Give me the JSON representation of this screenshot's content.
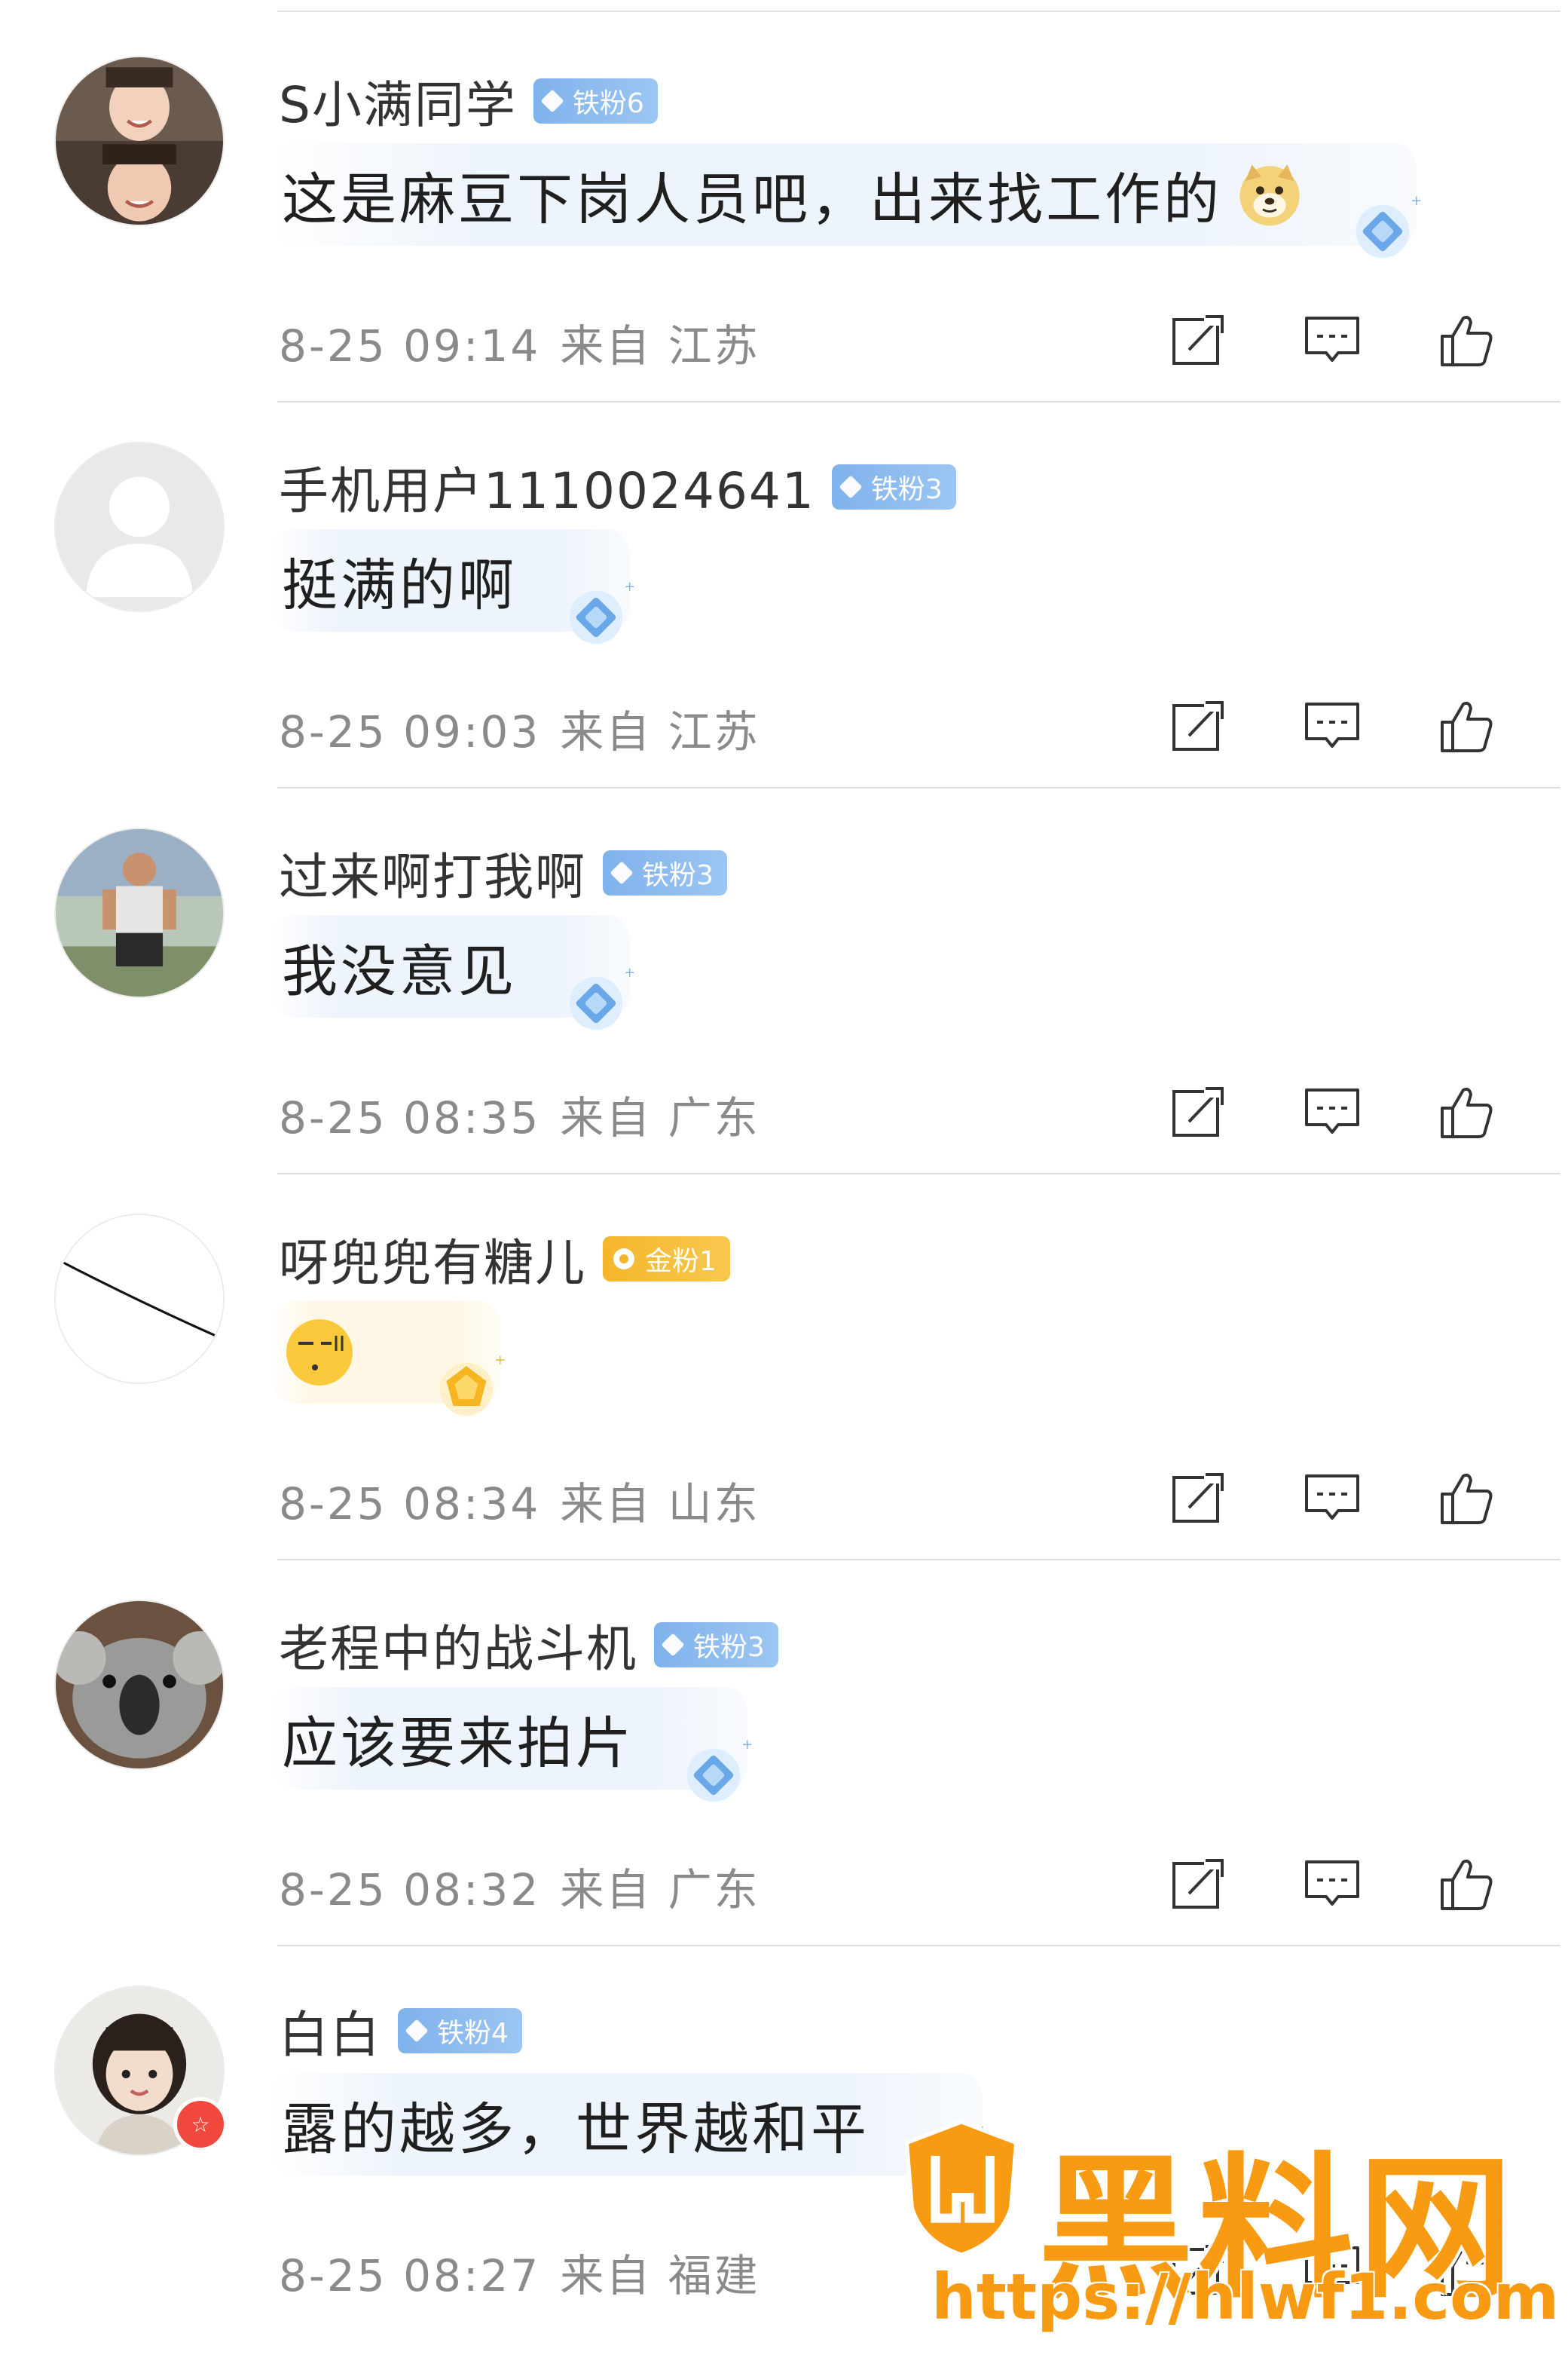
{
  "comments": [
    {
      "username": "S小满同学",
      "badge": "铁粉6",
      "badge_type": "blue",
      "text": "这是麻豆下岗人员吧，出来找工作的",
      "inline_emoji": "doge-emoji",
      "date": "8-25 09:14",
      "location": "来自 江苏",
      "avatar": "two-girls-photo"
    },
    {
      "username": "手机用户1110024641",
      "badge": "铁粉3",
      "badge_type": "blue",
      "text": "挺满的啊",
      "date": "8-25 09:03",
      "location": "来自 江苏",
      "avatar": "default-avatar"
    },
    {
      "username": "过来啊打我啊",
      "badge": "铁粉3",
      "badge_type": "blue",
      "text": "我没意见",
      "date": "8-25 08:35",
      "location": "来自 广东",
      "avatar": "man-photo"
    },
    {
      "username": "呀兜兜有糖儿",
      "badge": "金粉1",
      "badge_type": "gold",
      "text": "",
      "emoji_only": "speechless-emoji",
      "date": "8-25 08:34",
      "location": "来自 山东",
      "avatar": "white-line-avatar"
    },
    {
      "username": "老程中的战斗机",
      "badge": "铁粉3",
      "badge_type": "blue",
      "text": "应该要来拍片",
      "date": "8-25 08:32",
      "location": "来自 广东",
      "avatar": "koala-photo"
    },
    {
      "username": "白白",
      "badge": "铁粉4",
      "badge_type": "blue",
      "text": "露的越多，世界越和平",
      "date": "8-25 08:27",
      "location": "来自 福建",
      "avatar": "girl-photo"
    }
  ],
  "actions": {
    "repost_icon": "repost-icon",
    "comment_icon": "comment-icon",
    "like_icon": "like-icon"
  },
  "watermark": {
    "title": "黑料网",
    "url": "https://hlwf1.com",
    "brand_color": "#f89a12"
  },
  "colors": {
    "blue_badge": "#7fb2ec",
    "gold_badge": "#f5b62b",
    "meta_text": "#8a8a8a"
  }
}
